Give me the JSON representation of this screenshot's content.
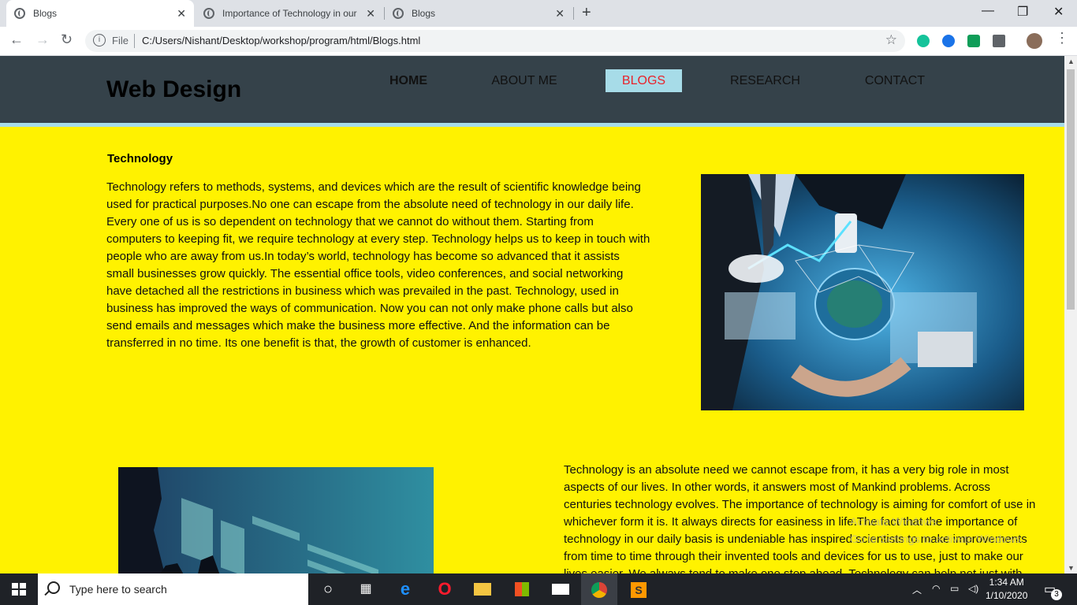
{
  "browser": {
    "tabs": [
      {
        "title": "Blogs",
        "active": true
      },
      {
        "title": "Importance of Technology in our",
        "active": false
      },
      {
        "title": "Blogs",
        "active": false
      }
    ],
    "omnibox": {
      "scheme_label": "File",
      "url": "C:/Users/Nishant/Desktop/workshop/program/html/Blogs.html"
    }
  },
  "site": {
    "logo": "Web Design",
    "nav": [
      "HOME",
      "ABOUT ME",
      "BLOGS",
      "RESEARCH",
      "CONTACT"
    ],
    "active_nav": "BLOGS",
    "section_title": "Technology",
    "paragraph1": "Technology refers to methods, systems, and devices which are the result of scientific knowledge being used for practical purposes.No one can escape from the absolute need of technology in our daily life. Every one of us is so dependent on technology that we cannot do without them. Starting from computers to keeping fit, we require technology at every step. Technology helps us to keep in touch with people who are away from us.In today’s world, technology has become so advanced that it assists small businesses grow quickly. The essential office tools, video conferences, and social networking have detached all the restrictions in business which was prevailed in the past. Technology, used in business has improved the ways of communication. Now you can not only make phone calls but also send emails and messages which make the business more effective. And the information can be transferred in no time. Its one benefit is that, the growth of customer is enhanced.",
    "paragraph2": "Technology is an absolute need we cannot escape from, it has a very big role in most aspects of our lives. In other words, it answers most of Mankind problems. Across centuries technology evolves. The importance of technology is aiming for comfort of use in whichever form it is. It always directs for easiness in life.The fact that the importance of technology in our daily basis is undeniable has inspired scientists to make improvements from time to time through their invented tools and devices for us to use, just to make our lives easier. We always tend to make one step ahead. Technology can help not just with",
    "watermark": [
      "Activate Windows",
      "Go to Settings to activate Windows."
    ]
  },
  "taskbar": {
    "search_placeholder": "Type here to search",
    "time": "1:34 AM",
    "date": "1/10/2020",
    "notification_count": "3"
  },
  "colors": {
    "page_bg": "#fff200",
    "header_bg": "#35424a",
    "accent": "#a7dce8",
    "active_nav_text": "#e8232b"
  }
}
